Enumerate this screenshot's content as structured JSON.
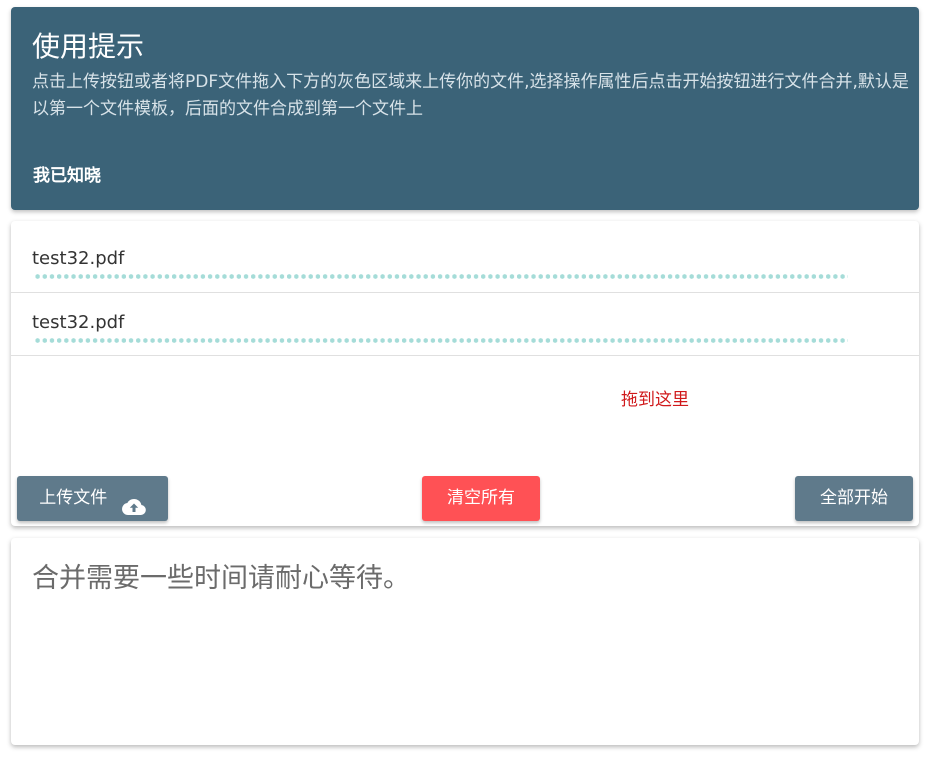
{
  "notice": {
    "title": "使用提示",
    "text": "点击上传按钮或者将PDF文件拖入下方的灰色区域来上传你的文件,选择操作属性后点击开始按钮进行文件合并,默认是以第一个文件模板，后面的文件合成到第一个文件上",
    "ack_label": "我已知晓"
  },
  "files": [
    {
      "name": "test32.pdf",
      "progress": 1.0
    },
    {
      "name": "test32.pdf",
      "progress": 1.0
    }
  ],
  "drop_hint": "拖到这里",
  "buttons": {
    "upload_label": "上传文件",
    "upload_icon": "cloud-upload-icon",
    "clear_label": "清空所有",
    "start_label": "全部开始"
  },
  "message": {
    "text": "合并需要一些时间请耐心等待。"
  },
  "colors": {
    "notice_bg": "#3b6378",
    "button_gray": "#5f7a8b",
    "button_red": "#ff5155",
    "hint_red": "#d0191b",
    "progress_dots": "#a5dcd8"
  }
}
